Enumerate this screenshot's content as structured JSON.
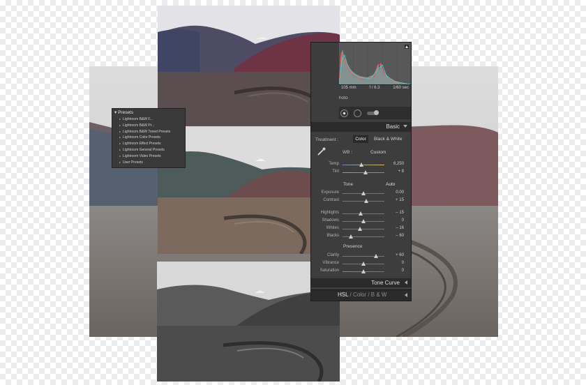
{
  "presets": {
    "title": "Presets",
    "items": [
      "Lightroom B&W F...",
      "Lightroom B&W Pr...",
      "Lightroom B&W Toned Presets",
      "Lightroom Color Presets",
      "Lightroom Effect Presets",
      "Lightroom General Presets",
      "Lightroom Video Presets",
      "User Presets"
    ]
  },
  "panel": {
    "exif": [
      "105 mm",
      "f / 6.3",
      "1/60 sec"
    ],
    "photo_label": "hoto",
    "section_title": "Basic",
    "treatment_label": "Treatment :",
    "treatment_color": "Color",
    "treatment_bw": "Black & White",
    "wb_label": "WB :",
    "wb_value": "Custom",
    "tone_label": "Tone",
    "tone_auto": "Auto",
    "presence_label": "Presence",
    "tone_curve_label": "Tone Curve",
    "hsl_tabs": [
      "HSL",
      "/",
      "Color",
      "/",
      "B & W"
    ],
    "sliders": [
      {
        "label": "Temp",
        "value": "6,250",
        "pos": 0.45
      },
      {
        "label": "Tint",
        "value": "+ 8",
        "pos": 0.55
      },
      {
        "label": "Exposure",
        "value": "0.00",
        "pos": 0.5
      },
      {
        "label": "Contrast",
        "value": "+ 15",
        "pos": 0.56
      },
      {
        "label": "Highlights",
        "value": "– 15",
        "pos": 0.44
      },
      {
        "label": "Shadows",
        "value": "0",
        "pos": 0.5
      },
      {
        "label": "Whites",
        "value": "– 16",
        "pos": 0.42
      },
      {
        "label": "Blacks",
        "value": "– 60",
        "pos": 0.2
      },
      {
        "label": "Clarity",
        "value": "+ 60",
        "pos": 0.8
      },
      {
        "label": "Vibrance",
        "value": "0",
        "pos": 0.5
      },
      {
        "label": "Saturation",
        "value": "0",
        "pos": 0.5
      }
    ]
  },
  "colors": {
    "panel_bg": "#3d3d3d",
    "temp_track": "#6a8fc0",
    "tint_track": "#7fb060",
    "sat_track": "#b04db0"
  }
}
